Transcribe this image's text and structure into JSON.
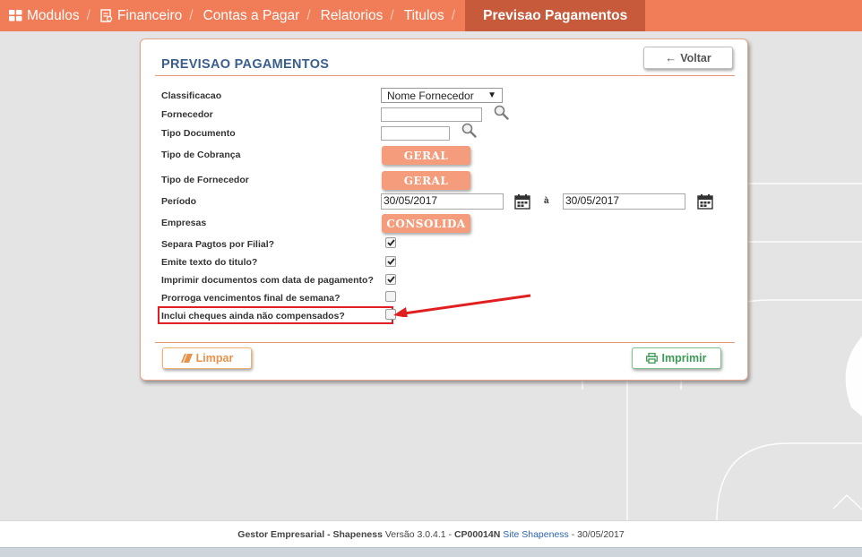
{
  "nav": {
    "items": [
      {
        "label": "Modulos",
        "icon": "grid-icon"
      },
      {
        "label": "Financeiro",
        "icon": "report-icon"
      },
      {
        "label": "Contas a Pagar"
      },
      {
        "label": "Relatorios"
      },
      {
        "label": "Titulos"
      }
    ],
    "separator": "/",
    "active_label": "Previsao Pagamentos"
  },
  "panel": {
    "title": "PREVISAO PAGAMENTOS",
    "back_button": "Voltar",
    "clear_button": "Limpar",
    "print_button": "Imprimir"
  },
  "form": {
    "classificacao": {
      "label": "Classificacao",
      "value": "Nome Fornecedor"
    },
    "fornecedor": {
      "label": "Fornecedor",
      "value": ""
    },
    "tipo_documento": {
      "label": "Tipo Documento",
      "value": ""
    },
    "tipo_cobranca": {
      "label": "Tipo de Cobrança",
      "value": "GERAL"
    },
    "tipo_fornecedor": {
      "label": "Tipo de Fornecedor",
      "value": "GERAL"
    },
    "periodo": {
      "label": "Período",
      "from": "30/05/2017",
      "separator": "à",
      "to": "30/05/2017"
    },
    "empresas": {
      "label": "Empresas",
      "value": "CONSOLIDA"
    },
    "checks": [
      {
        "label": "Separa Pagtos por Filial?",
        "checked": true
      },
      {
        "label": "Emite texto do titulo?",
        "checked": true
      },
      {
        "label": "Imprimir documentos com data de pagamento?",
        "checked": true
      },
      {
        "label": "Prorroga vencimentos final de semana?",
        "checked": false
      },
      {
        "label": "Inclui cheques ainda não compensados?",
        "checked": false
      }
    ]
  },
  "footer": {
    "app": "Gestor Empresarial - Shapeness",
    "version_label": "Versão 3.0.4.1 -",
    "code": "CP00014N",
    "link": "Site Shapeness",
    "date": "- 30/05/2017"
  },
  "colors": {
    "nav": "#f07c58",
    "nav_active": "#c85a3c",
    "title": "#3a5f8f",
    "orange_button": "#f59c7c",
    "highlight": "#e02020"
  }
}
